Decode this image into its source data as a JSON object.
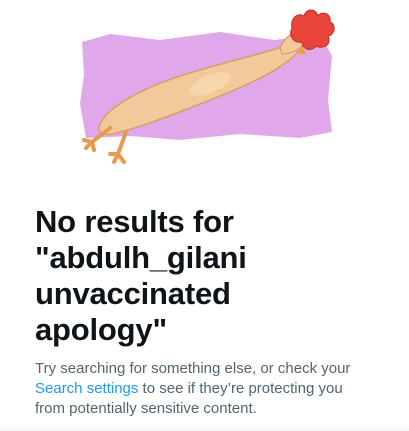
{
  "empty_state": {
    "illustration_icon": "rubber-chicken-illustration",
    "headline_lines": [
      "No results for",
      "\"abdulh_gilani",
      "unvaccinated",
      "apology\""
    ],
    "subtext": {
      "line1": "Try searching for something else, or check your",
      "link_label": "Search settings",
      "line2_rest": " to see if they’re protecting you",
      "line3": "from potentially sensitive content."
    }
  },
  "colors": {
    "text_primary": "#0f1419",
    "text_secondary": "#536471",
    "link": "#1d9bf0",
    "illustration_bg": "#e0a7ea"
  }
}
